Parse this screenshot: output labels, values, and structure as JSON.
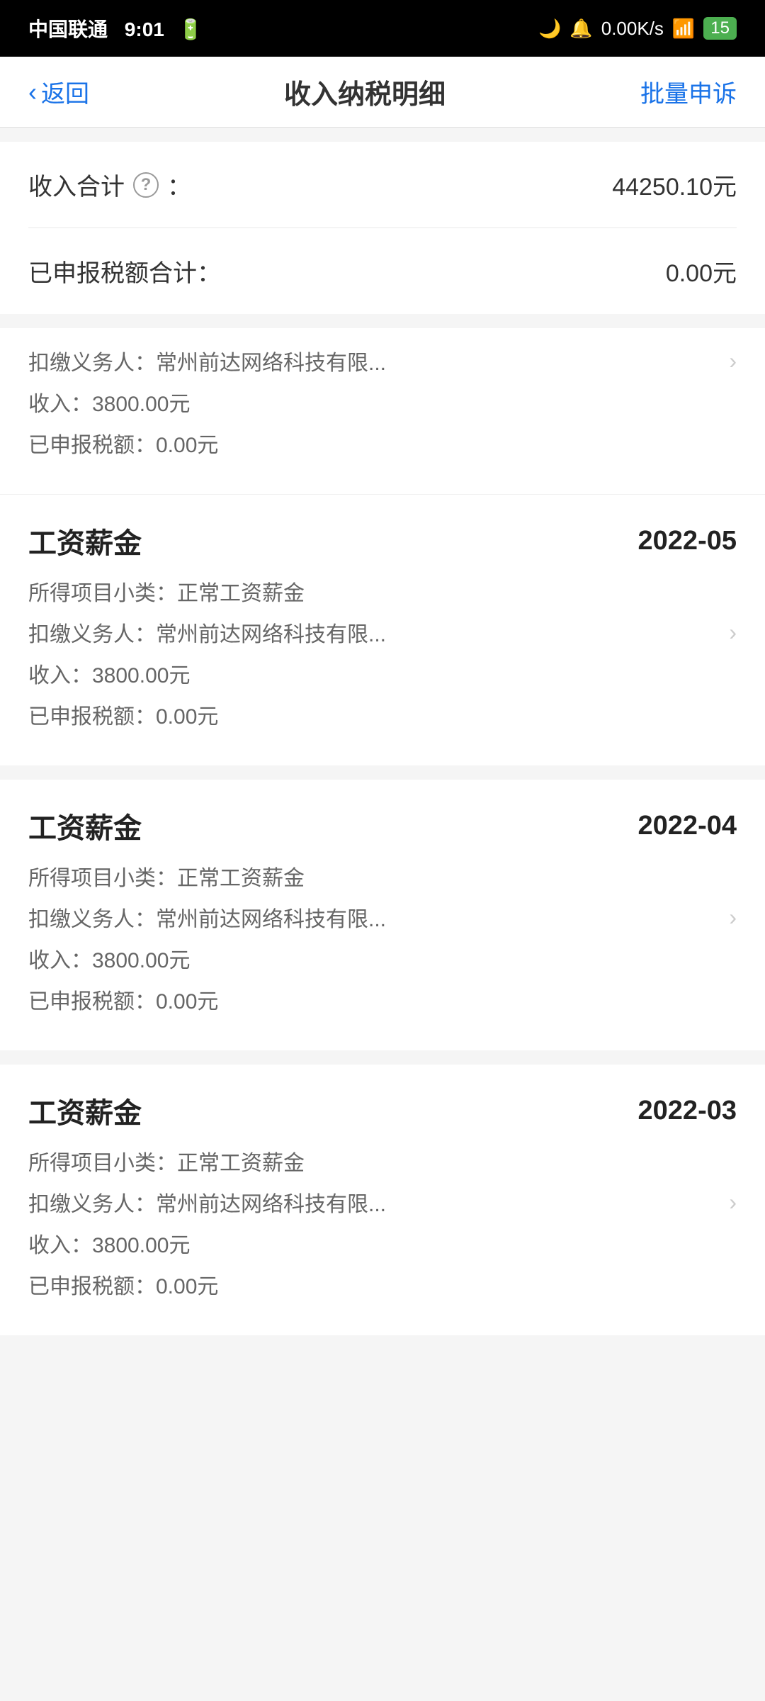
{
  "statusBar": {
    "carrier": "中国联通",
    "time": "9:01",
    "network": "0.00K/s",
    "battery": "15"
  },
  "navBar": {
    "backLabel": "返回",
    "title": "收入纳税明细",
    "actionLabel": "批量申诉"
  },
  "summary": {
    "totalIncomeLabel": "收入合计",
    "totalIncomeValue": "44250.10元",
    "totalTaxLabel": "已申报税额合计：",
    "totalTaxValue": "0.00元"
  },
  "partialCard": {
    "payerLabel": "扣缴义务人：常州前达网络科技有限...",
    "incomeLabel": "收入：3800.00元",
    "taxLabel": "已申报税额：0.00元"
  },
  "records": [
    {
      "type": "工资薪金",
      "date": "2022-05",
      "subCategory": "所得项目小类：正常工资薪金",
      "payer": "扣缴义务人：常州前达网络科技有限...",
      "income": "收入：3800.00元",
      "tax": "已申报税额：0.00元"
    },
    {
      "type": "工资薪金",
      "date": "2022-04",
      "subCategory": "所得项目小类：正常工资薪金",
      "payer": "扣缴义务人：常州前达网络科技有限...",
      "income": "收入：3800.00元",
      "tax": "已申报税额：0.00元"
    },
    {
      "type": "工资薪金",
      "date": "2022-03",
      "subCategory": "所得项目小类：正常工资薪金",
      "payer": "扣缴义务人：常州前达网络科技有限...",
      "income": "收入：3800.00元",
      "tax": "已申报税额：0.00元"
    }
  ]
}
